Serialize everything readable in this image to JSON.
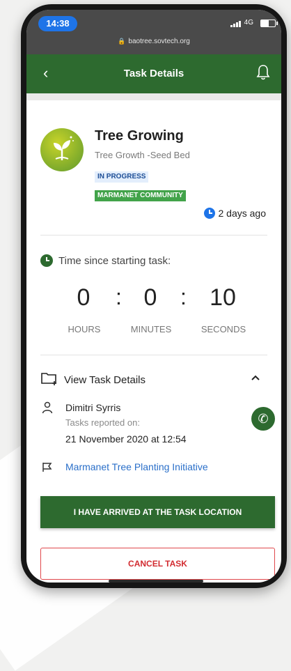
{
  "status_bar": {
    "time": "14:38",
    "network": "4G"
  },
  "browser": {
    "url": "baotree.sovtech.org"
  },
  "app_bar": {
    "title": "Task Details"
  },
  "task": {
    "title": "Tree Growing",
    "subtitle": "Tree Growth -Seed Bed",
    "status_badge": "IN PROGRESS",
    "community_badge": "MARMANET COMMUNITY",
    "posted_ago": "2 days ago"
  },
  "timer": {
    "label": "Time since starting task:",
    "hours": "0",
    "minutes": "0",
    "seconds": "10",
    "separator": ":",
    "hours_label": "HOURS",
    "minutes_label": "MINUTES",
    "seconds_label": "SECONDS"
  },
  "details": {
    "toggle_label": "View Task Details",
    "reporter_name": "Dimitri Syrris",
    "reported_label": "Tasks reported on:",
    "reported_date": "21 November 2020 at 12:54",
    "initiative_link": "Marmanet Tree Planting Initiative"
  },
  "actions": {
    "arrived_label": "I HAVE ARRIVED AT THE TASK LOCATION",
    "cancel_label": "CANCEL TASK"
  },
  "colors": {
    "primary_green": "#2d6a2f",
    "badge_green": "#42a34a",
    "link_blue": "#2a6fc9",
    "cancel_red": "#d22b30",
    "time_pill_blue": "#1e74e8"
  },
  "icons": [
    "back-arrow-icon",
    "bell-icon",
    "plant-icon",
    "clock-icon",
    "timer-clock-icon",
    "folder-add-icon",
    "chevron-up-icon",
    "person-icon",
    "phone-icon",
    "flag-icon",
    "lock-icon"
  ]
}
